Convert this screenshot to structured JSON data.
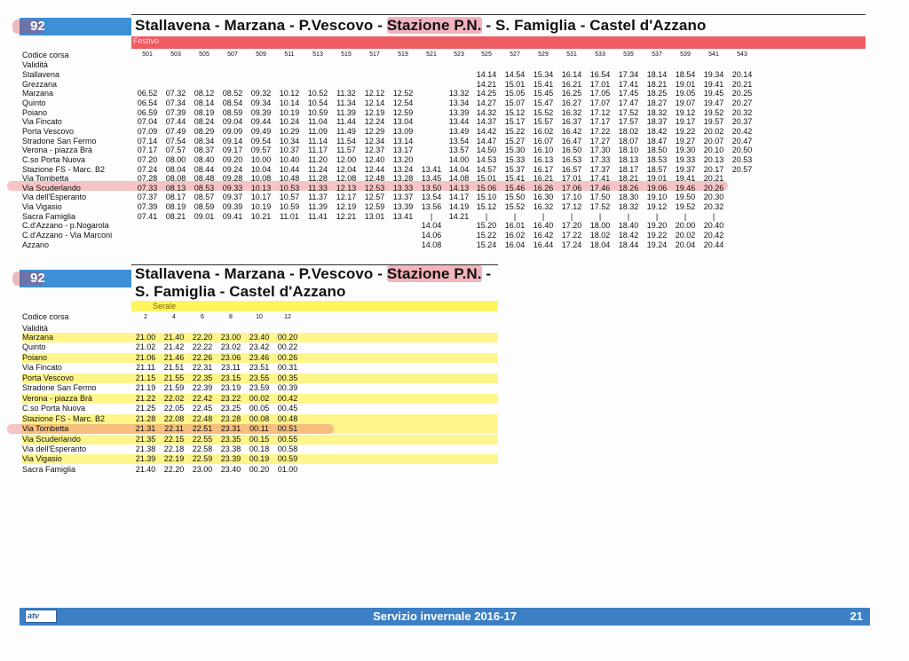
{
  "section1": {
    "route": "92",
    "title_part1": "Stallavena - Marzana - P.Vescovo - ",
    "title_highlight": "Stazione P.N.",
    "title_part2": " - S. Famiglia - Castel d'Azzano",
    "band_label": "Festivo",
    "codice_label": "Codice corsa",
    "validita_label": "Validità",
    "codes": [
      "501",
      "503",
      "505",
      "507",
      "509",
      "511",
      "513",
      "515",
      "517",
      "519",
      "521",
      "523",
      "525",
      "527",
      "529",
      "531",
      "533",
      "535",
      "537",
      "539",
      "541",
      "543"
    ],
    "stops": [
      "Stallavena",
      "Grezzana",
      "Marzana",
      "Quinto",
      "Poiano",
      "Via Fincato",
      "Porta Vescovo",
      "Stradone San Fermo",
      "Verona - piazza Brà",
      "C.so Porta Nuova",
      "Stazione FS - Marc. B2",
      "Via Tombetta",
      "Via Scuderlando",
      "Via dell'Esperanto",
      "Via Vigasio",
      "Sacra Famiglia",
      "C.d'Azzano - p.Nogarola",
      "C.d'Azzano - Via Marconi",
      "Azzano"
    ],
    "times": [
      [
        "",
        "",
        "",
        "",
        "",
        "",
        "",
        "",
        "",
        "",
        "",
        "",
        "14.14",
        "14.54",
        "15.34",
        "16.14",
        "16.54",
        "17.34",
        "18.14",
        "18.54",
        "19.34",
        "20.14"
      ],
      [
        "",
        "",
        "",
        "",
        "",
        "",
        "",
        "",
        "",
        "",
        "",
        "",
        "14.21",
        "15.01",
        "15.41",
        "16.21",
        "17.01",
        "17.41",
        "18.21",
        "19.01",
        "19.41",
        "20.21"
      ],
      [
        "06.52",
        "07.32",
        "08.12",
        "08.52",
        "09.32",
        "10.12",
        "10.52",
        "11.32",
        "12.12",
        "12.52",
        "",
        "13.32",
        "14.25",
        "15.05",
        "15.45",
        "16.25",
        "17.05",
        "17.45",
        "18.25",
        "19.05",
        "19.45",
        "20.25"
      ],
      [
        "06.54",
        "07.34",
        "08.14",
        "08.54",
        "09.34",
        "10.14",
        "10.54",
        "11.34",
        "12.14",
        "12.54",
        "",
        "13.34",
        "14.27",
        "15.07",
        "15.47",
        "16.27",
        "17.07",
        "17.47",
        "18.27",
        "19.07",
        "19.47",
        "20.27"
      ],
      [
        "06.59",
        "07.39",
        "08.19",
        "08.59",
        "09.39",
        "10.19",
        "10.59",
        "11.39",
        "12.19",
        "12.59",
        "",
        "13.39",
        "14.32",
        "15.12",
        "15.52",
        "16.32",
        "17.12",
        "17.52",
        "18.32",
        "19.12",
        "19.52",
        "20.32"
      ],
      [
        "07.04",
        "07.44",
        "08.24",
        "09.04",
        "09.44",
        "10.24",
        "11.04",
        "11.44",
        "12.24",
        "13.04",
        "",
        "13.44",
        "14.37",
        "15.17",
        "15.57",
        "16.37",
        "17.17",
        "17.57",
        "18.37",
        "19.17",
        "19.57",
        "20.37"
      ],
      [
        "07.09",
        "07.49",
        "08.29",
        "09.09",
        "09.49",
        "10.29",
        "11.09",
        "11.49",
        "12.29",
        "13.09",
        "",
        "13.49",
        "14.42",
        "15.22",
        "16.02",
        "16.42",
        "17.22",
        "18.02",
        "18.42",
        "19.22",
        "20.02",
        "20.42"
      ],
      [
        "07.14",
        "07.54",
        "08.34",
        "09.14",
        "09.54",
        "10.34",
        "11.14",
        "11.54",
        "12.34",
        "13.14",
        "",
        "13.54",
        "14.47",
        "15.27",
        "16.07",
        "16.47",
        "17.27",
        "18.07",
        "18.47",
        "19.27",
        "20.07",
        "20.47"
      ],
      [
        "07.17",
        "07.57",
        "08.37",
        "09.17",
        "09.57",
        "10.37",
        "11.17",
        "11.57",
        "12.37",
        "13.17",
        "",
        "13.57",
        "14.50",
        "15.30",
        "16.10",
        "16.50",
        "17.30",
        "18.10",
        "18.50",
        "19.30",
        "20.10",
        "20.50"
      ],
      [
        "07.20",
        "08.00",
        "08.40",
        "09.20",
        "10.00",
        "10.40",
        "11.20",
        "12.00",
        "12.40",
        "13.20",
        "",
        "14.00",
        "14.53",
        "15.33",
        "16.13",
        "16.53",
        "17.33",
        "18.13",
        "18.53",
        "19.33",
        "20.13",
        "20.53"
      ],
      [
        "07.24",
        "08.04",
        "08.44",
        "09.24",
        "10.04",
        "10.44",
        "11.24",
        "12.04",
        "12.44",
        "13.24",
        "13.41",
        "14.04",
        "14.57",
        "15.37",
        "16.17",
        "16.57",
        "17.37",
        "18.17",
        "18.57",
        "19.37",
        "20.17",
        "20.57"
      ],
      [
        "07.28",
        "08.08",
        "08.48",
        "09.28",
        "10.08",
        "10.48",
        "11.28",
        "12.08",
        "12.48",
        "13.28",
        "13.45",
        "14.08",
        "15.01",
        "15.41",
        "16.21",
        "17.01",
        "17.41",
        "18.21",
        "19.01",
        "19.41",
        "20.21",
        ""
      ],
      [
        "07.33",
        "08.13",
        "08.53",
        "09.33",
        "10.13",
        "10.53",
        "11.33",
        "12.13",
        "12.53",
        "13.33",
        "13.50",
        "14.13",
        "15.06",
        "15.46",
        "16.26",
        "17.06",
        "17.46",
        "18.26",
        "19.06",
        "19.46",
        "20.26",
        ""
      ],
      [
        "07.37",
        "08.17",
        "08.57",
        "09.37",
        "10.17",
        "10.57",
        "11.37",
        "12.17",
        "12.57",
        "13.37",
        "13.54",
        "14.17",
        "15.10",
        "15.50",
        "16.30",
        "17.10",
        "17.50",
        "18.30",
        "19.10",
        "19.50",
        "20.30",
        ""
      ],
      [
        "07.39",
        "08.19",
        "08.59",
        "09.39",
        "10.19",
        "10.59",
        "11.39",
        "12.19",
        "12.59",
        "13.39",
        "13.56",
        "14.19",
        "15.12",
        "15.52",
        "16.32",
        "17.12",
        "17.52",
        "18.32",
        "19.12",
        "19.52",
        "20.32",
        ""
      ],
      [
        "07.41",
        "08.21",
        "09.01",
        "09.41",
        "10.21",
        "11.01",
        "11.41",
        "12.21",
        "13.01",
        "13.41",
        "|",
        "14.21",
        "|",
        "|",
        "|",
        "|",
        "|",
        "|",
        "|",
        "|",
        "|",
        ""
      ],
      [
        "",
        "",
        "",
        "",
        "",
        "",
        "",
        "",
        "",
        "",
        "14.04",
        "",
        "15.20",
        "16.01",
        "16.40",
        "17.20",
        "18.00",
        "18.40",
        "19.20",
        "20.00",
        "20.40",
        ""
      ],
      [
        "",
        "",
        "",
        "",
        "",
        "",
        "",
        "",
        "",
        "",
        "14.06",
        "",
        "15.22",
        "16.02",
        "16.42",
        "17.22",
        "18.02",
        "18.42",
        "19.22",
        "20.02",
        "20.42",
        ""
      ],
      [
        "",
        "",
        "",
        "",
        "",
        "",
        "",
        "",
        "",
        "",
        "14.08",
        "",
        "15.24",
        "16.04",
        "16.44",
        "17.24",
        "18.04",
        "18.44",
        "19.24",
        "20.04",
        "20.44",
        ""
      ]
    ]
  },
  "section2": {
    "route": "92",
    "title_line1_part1": "Stallavena - Marzana - P.Vescovo - ",
    "title_line1_highlight": "Stazione P.N.",
    "title_line1_part2": " -",
    "title_line2": "S. Famiglia - Castel d'Azzano",
    "band_label": "Serale",
    "codice_label": "Codice corsa",
    "validita_label": "Validità",
    "codes": [
      "2",
      "4",
      "6",
      "8",
      "10",
      "12"
    ],
    "stops": [
      "Marzana",
      "Quinto",
      "Poiano",
      "Via Fincato",
      "Porta Vescovo",
      "Stradone San Fermo",
      "Verona - piazza Brà",
      "C.so Porta Nuova",
      "Stazione FS - Marc. B2",
      "Via Tombetta",
      "Via Scuderlando",
      "Via dell'Esperanto",
      "Via Vigasio",
      "Sacra Famiglia"
    ],
    "times": [
      [
        "21.00",
        "21.40",
        "22.20",
        "23.00",
        "23.40",
        "00.20"
      ],
      [
        "21.02",
        "21.42",
        "22.22",
        "23.02",
        "23.42",
        "00.22"
      ],
      [
        "21.06",
        "21.46",
        "22.26",
        "23.06",
        "23.46",
        "00.26"
      ],
      [
        "21.11",
        "21.51",
        "22.31",
        "23.11",
        "23.51",
        "00.31"
      ],
      [
        "21.15",
        "21.55",
        "22.35",
        "23.15",
        "23.55",
        "00.35"
      ],
      [
        "21.19",
        "21.59",
        "22.39",
        "23.19",
        "23.59",
        "00.39"
      ],
      [
        "21.22",
        "22.02",
        "22.42",
        "23.22",
        "00.02",
        "00.42"
      ],
      [
        "21.25",
        "22.05",
        "22.45",
        "23.25",
        "00.05",
        "00.45"
      ],
      [
        "21.28",
        "22.08",
        "22.48",
        "23.28",
        "00.08",
        "00.48"
      ],
      [
        "21.31",
        "22.11",
        "22.51",
        "23.31",
        "00.11",
        "00.51"
      ],
      [
        "21.35",
        "22.15",
        "22.55",
        "23.35",
        "00.15",
        "00.55"
      ],
      [
        "21.38",
        "22.18",
        "22.58",
        "23.38",
        "00.18",
        "00.58"
      ],
      [
        "21.39",
        "22.19",
        "22.59",
        "23.39",
        "00.19",
        "00.59"
      ],
      [
        "21.40",
        "22.20",
        "23.00",
        "23.40",
        "00.20",
        "01.00"
      ]
    ]
  },
  "footer": {
    "logo_text": "atv",
    "service": "Servizio invernale 2016-17",
    "page": "21"
  },
  "colors": {
    "badge_blue": "#3d8fd6",
    "band_red": "#ef5d62",
    "band_yellow": "#fff45c",
    "footer_blue": "#3c7fc4"
  }
}
